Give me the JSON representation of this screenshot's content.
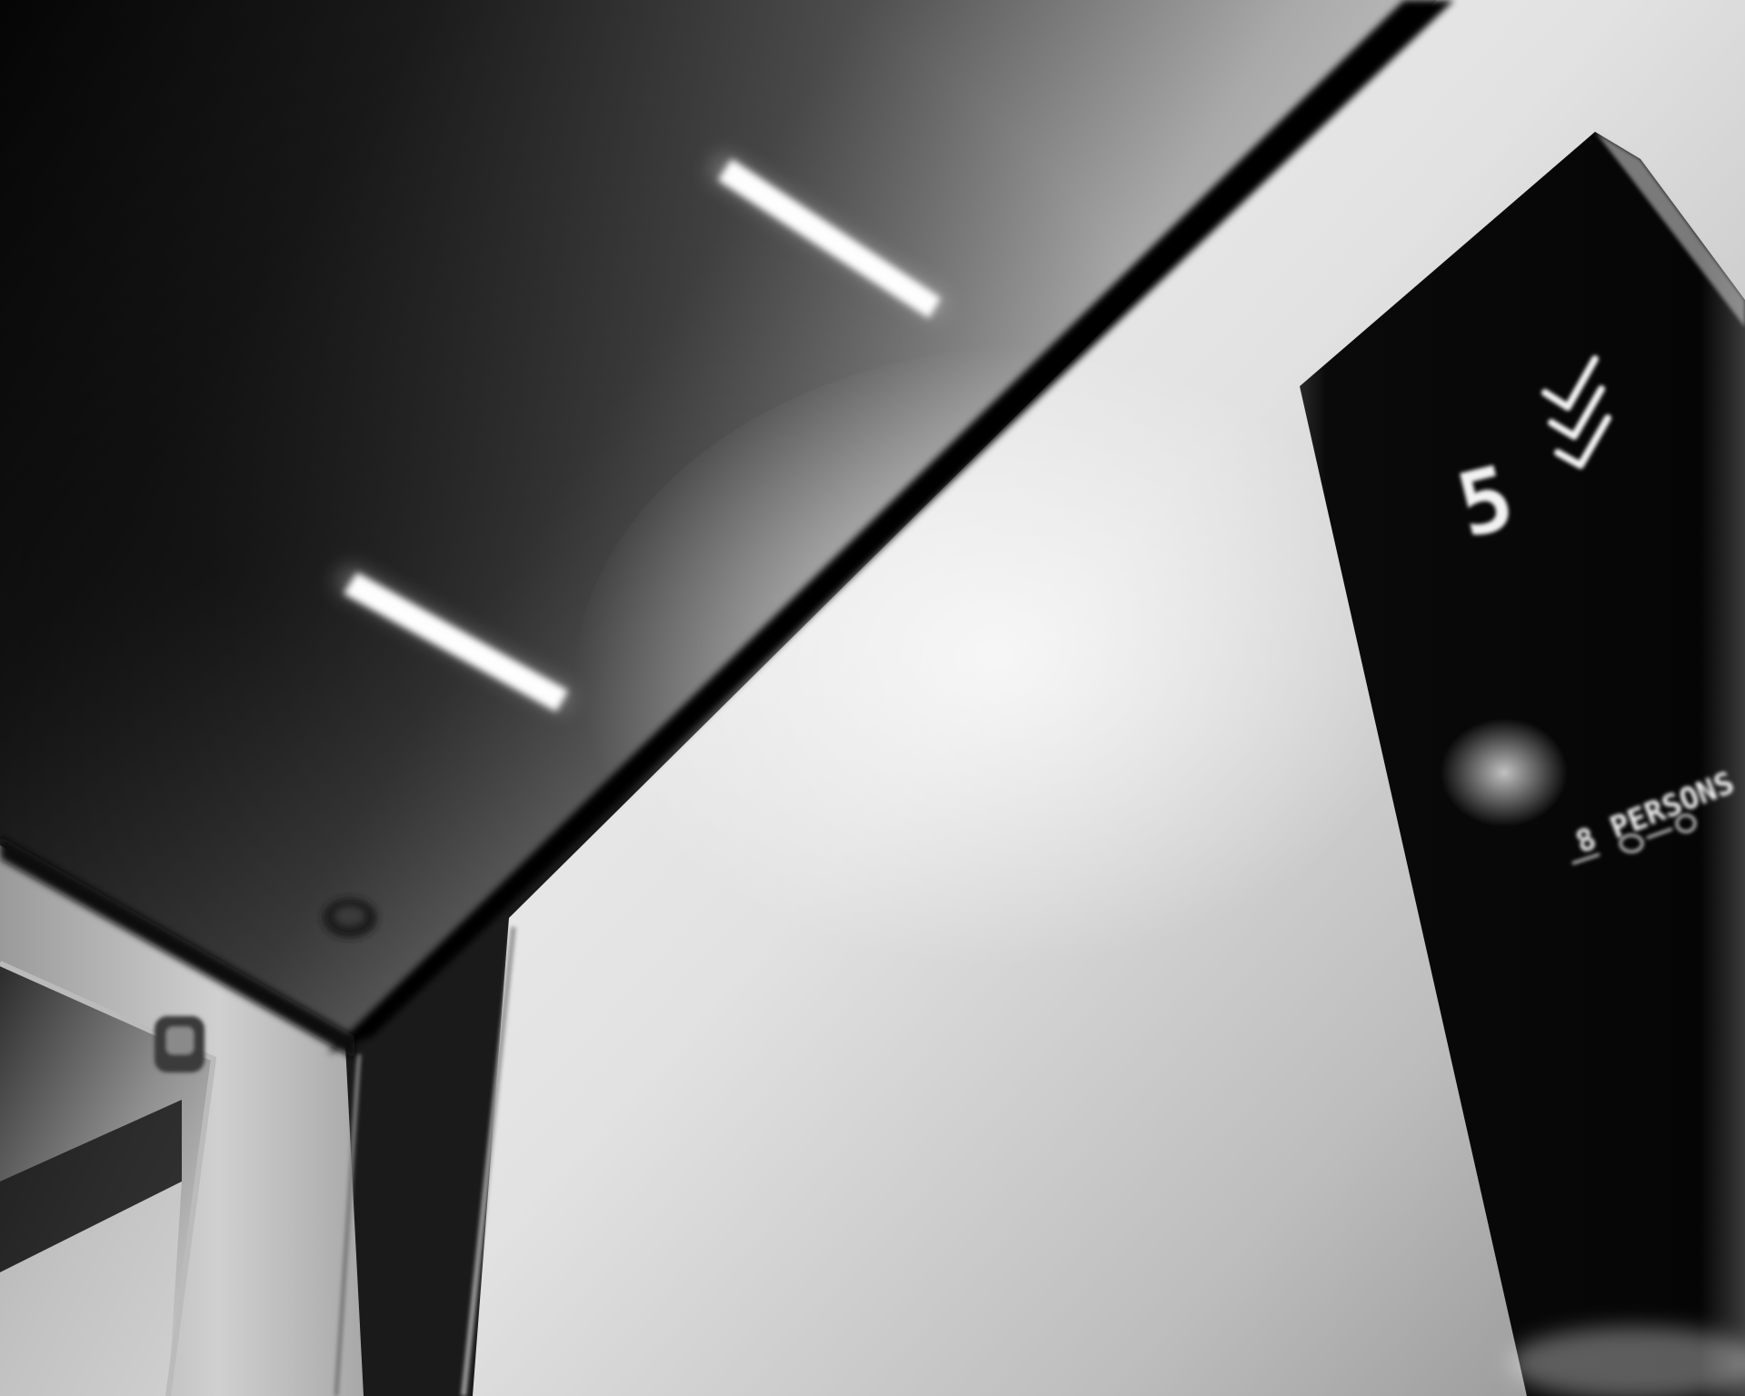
{
  "scene": {
    "description_free": true,
    "subject": "elevator-cabin-ceiling-and-wall",
    "palette": {
      "ceiling_dark": "#0c0c0c",
      "ceiling_mid": "#6f6f6f",
      "ceiling_light": "#cfcfcf",
      "wall_light": "#e6e6e6",
      "wall_shadow": "#8a8a8a",
      "trim_black": "#050505",
      "light_panel": "#fafafa",
      "display_panel": "#070707",
      "display_glow": "#f5f5f5"
    }
  },
  "floor_display": {
    "floor_number": "5",
    "direction": "down",
    "direction_icon": "triple-chevron-down-icon",
    "capacity_label": "8 PERSONS"
  }
}
